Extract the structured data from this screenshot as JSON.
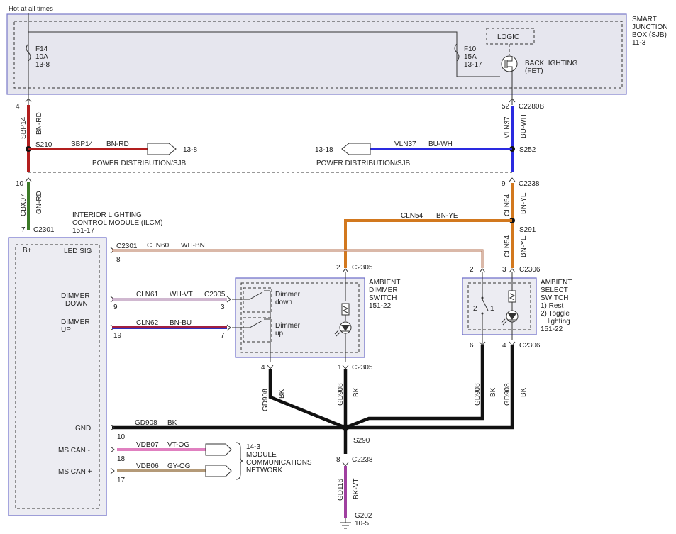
{
  "header": {
    "hot_label": "Hot at all times"
  },
  "sjb": {
    "title": [
      "SMART",
      "JUNCTION",
      "BOX (SJB)",
      "11-3"
    ],
    "fuse_f14": [
      "F14",
      "10A",
      "13-8"
    ],
    "fuse_f10": [
      "F10",
      "15A",
      "13-17"
    ],
    "logic": "LOGIC",
    "backlighting": [
      "BACKLIGHTING",
      "(FET)"
    ]
  },
  "wires": {
    "sbp14": {
      "circuit": "SBP14",
      "color": "BN-RD",
      "pin": "4"
    },
    "vln37": {
      "circuit": "VLN37",
      "color": "BU-WH",
      "pin": "52",
      "connector": "C2280B"
    },
    "s210": "S210",
    "s252": "S252",
    "pd_left": {
      "circuit": "SBP14",
      "color": "BN-RD",
      "ref": "13-8",
      "label": "POWER DISTRIBUTION/SJB"
    },
    "pd_right": {
      "circuit": "VLN37",
      "color": "BU-WH",
      "ref": "13-18",
      "label": "POWER DISTRIBUTION/SJB"
    },
    "cbx07": {
      "circuit": "CBX07",
      "color": "GN-RD",
      "pin_top": "10",
      "pin_bottom": "7",
      "connector": "C2301"
    },
    "cln54_a": {
      "circuit": "CLN54",
      "color": "BN-YE",
      "pin": "9",
      "connector": "C2238"
    },
    "cln54_h": {
      "circuit": "CLN54",
      "color": "BN-YE"
    },
    "s291": "S291",
    "cln54_b": {
      "circuit": "CLN54",
      "color": "BN-YE"
    },
    "cln60": {
      "connector": "C2301",
      "circuit": "CLN60",
      "color": "WH-BN",
      "pin": "8"
    },
    "cln61": {
      "circuit": "CLN61",
      "color": "WH-VT",
      "connector": "C2305",
      "pin_left": "9",
      "pin_right": "3"
    },
    "cln62": {
      "circuit": "CLN62",
      "color": "BN-BU",
      "pin_left": "19",
      "pin_right": "7"
    },
    "gd908_gnd": {
      "circuit": "GD908",
      "color": "BK",
      "pin": "10"
    },
    "vdb07": {
      "circuit": "VDB07",
      "color": "VT-OG",
      "pin": "18"
    },
    "vdb06": {
      "circuit": "VDB06",
      "color": "GY-OG",
      "pin": "17"
    },
    "gd908_a": {
      "circuit": "GD908",
      "color": "BK",
      "pin": "4"
    },
    "gd908_b": {
      "circuit": "GD908",
      "color": "BK",
      "pin": "1",
      "connector": "C2305"
    },
    "gd908_c": {
      "circuit": "GD908",
      "color": "BK",
      "pin": "6"
    },
    "gd908_d": {
      "circuit": "GD908",
      "color": "BK",
      "pin": "4",
      "connector": "C2306"
    },
    "s290": "S290",
    "gd116": {
      "circuit": "GD116",
      "color": "BK-VT",
      "pin": "8",
      "connector": "C2238"
    },
    "ground": [
      "G202",
      "10-5"
    ]
  },
  "ilcm": {
    "title": [
      "INTERIOR LIGHTING",
      "CONTROL MODULE (ILCM)",
      "151-17"
    ],
    "b_plus": "B+",
    "led_sig": "LED SIG",
    "dimmer_down": [
      "DIMMER",
      "DOWN"
    ],
    "dimmer_up": [
      "DIMMER",
      "UP"
    ],
    "gnd": "GND",
    "ms_can_minus": "MS CAN -",
    "ms_can_plus": "MS CAN +"
  },
  "dimmer_switch": {
    "title": [
      "AMBIENT",
      "DIMMER",
      "SWITCH",
      "151-22"
    ],
    "connector": "C2305",
    "pin_top": "2",
    "dimmer_down": [
      "Dimmer",
      "down"
    ],
    "dimmer_up": [
      "Dimmer",
      "up"
    ]
  },
  "select_switch": {
    "title": [
      "AMBIENT",
      "SELECT",
      "SWITCH"
    ],
    "options": [
      "1) Rest",
      "2) Toggle",
      "lighting",
      "151-22"
    ],
    "connector": "C2306",
    "pin_left": "2",
    "pin_right": "3",
    "contact_labels": [
      "2",
      "1"
    ],
    "bottom_connector": "C2306"
  },
  "network": [
    "14-3",
    "MODULE",
    "COMMUNICATIONS",
    "NETWORK"
  ],
  "colors": {
    "bn_rd": "#b21e1e",
    "bu_wh": "#2a2ae0",
    "gn_rd": "#3c7a28",
    "bn_ye": "#d2781e",
    "vt_og": "#e080c0",
    "gy_og": "#b49a78",
    "bk_vt": "#a040a0",
    "bk": "#111111"
  }
}
